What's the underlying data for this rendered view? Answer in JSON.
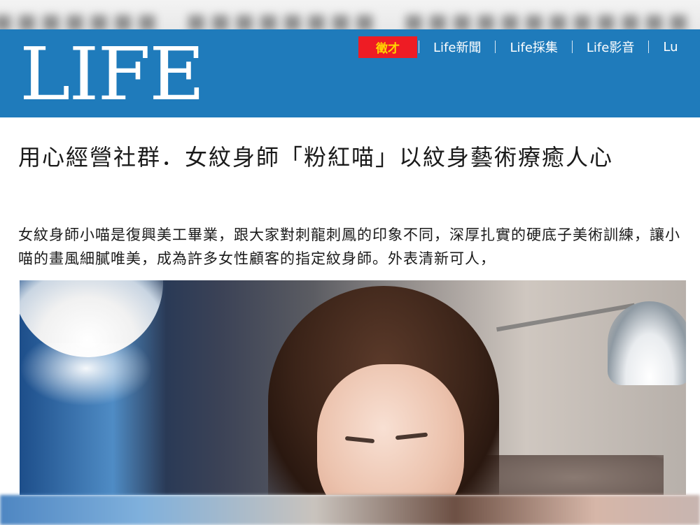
{
  "header": {
    "logo": "LIFE",
    "nav": {
      "badge": "徵才",
      "items": [
        "Life新聞",
        "Life採集",
        "Life影音",
        "Lu"
      ]
    }
  },
  "article": {
    "headline": "用心經營社群．女紋身師「粉紅喵」以紋身藝術療癒人心",
    "lede": "女紋身師小喵是復興美工畢業，跟大家對刺龍刺鳳的印象不同，深厚扎實的硬底子美術訓練，讓小喵的畫風細膩唯美，成為許多女性顧客的指定紋身師。外表清新可人，"
  },
  "colors": {
    "header_bg": "#1f7bbb",
    "badge_bg": "#ee1c24",
    "badge_text": "#ffd700"
  }
}
